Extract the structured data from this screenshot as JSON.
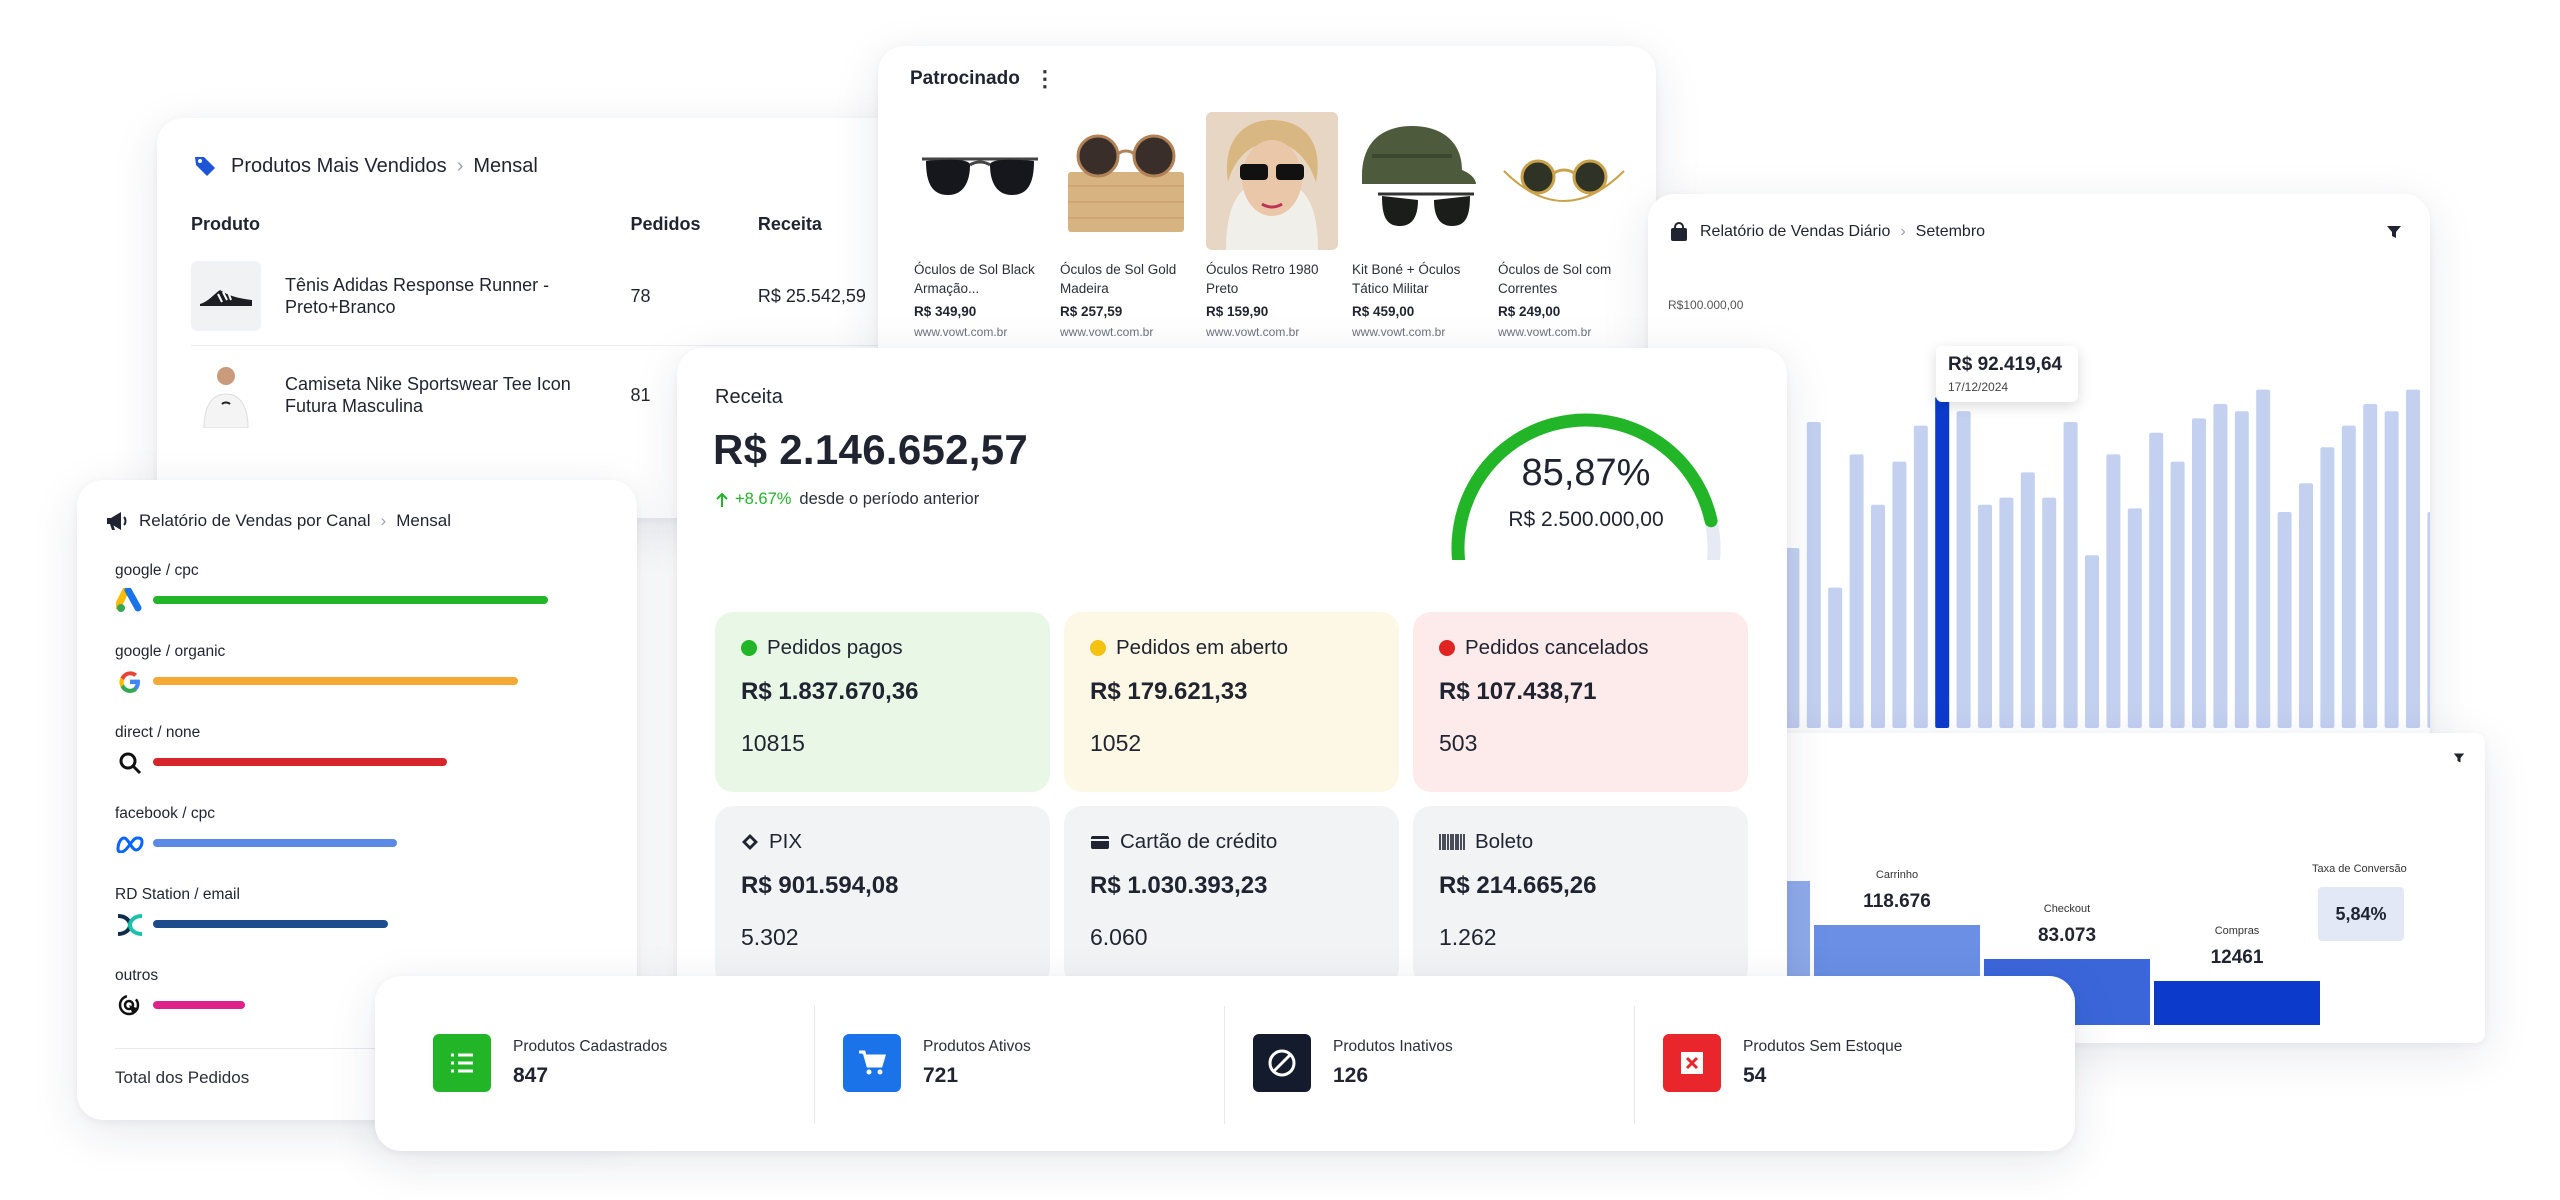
{
  "best_sellers": {
    "title": "Produtos Mais Vendidos",
    "period": "Mensal",
    "columns": [
      "Produto",
      "Pedidos",
      "Receita"
    ],
    "rows": [
      {
        "name_line1": "Tênis Adidas Response Runner -",
        "name_line2": "Preto+Branco",
        "orders": "78",
        "revenue": "R$ 25.542,59"
      },
      {
        "name_line1": "Camiseta Nike Sportswear Tee Icon",
        "name_line2": "Futura Masculina",
        "orders": "81",
        "revenue": ""
      }
    ]
  },
  "sponsored": {
    "title": "Patrocinado",
    "products": [
      {
        "name": "Óculos de Sol Black Armação...",
        "price": "R$ 349,90",
        "store": "www.vowt.com.br"
      },
      {
        "name": "Óculos de Sol Gold Madeira",
        "price": "R$ 257,59",
        "store": "www.vowt.com.br"
      },
      {
        "name": "Óculos Retro 1980 Preto",
        "price": "R$ 159,90",
        "store": "www.vowt.com.br"
      },
      {
        "name": "Kit Boné + Óculos Tático Militar",
        "price": "R$ 459,00",
        "store": "www.vowt.com.br"
      },
      {
        "name": "Óculos de Sol com Correntes",
        "price": "R$ 249,00",
        "store": "www.vowt.com.br"
      }
    ]
  },
  "daily_sales": {
    "title": "Relatório de Vendas Diário",
    "period": "Setembro",
    "y_top_label": "R$100.000,00",
    "tooltip_value": "R$ 92.419,64",
    "tooltip_date": "17/12/2024",
    "highlight_index": 8
  },
  "chart_data": {
    "type": "bar",
    "title": "Relatório de Vendas Diário",
    "series": [
      {
        "values": [
          62,
          50,
          85,
          39,
          76,
          62,
          74,
          84,
          92,
          88,
          62,
          64,
          71,
          64,
          85,
          48,
          76,
          61,
          82,
          74,
          86,
          90,
          88,
          94,
          60,
          68,
          78,
          84,
          90,
          88,
          94,
          60
        ]
      }
    ],
    "ylim": [
      0,
      100000
    ],
    "highlight": {
      "index": 8,
      "label": "R$ 92.419,64",
      "date": "17/12/2024"
    }
  },
  "funnel": {
    "stages": [
      {
        "label": "Carrinho",
        "value": "118.676",
        "level": 0.58
      },
      {
        "label": "Checkout",
        "value": "83.073",
        "level": 0.41
      },
      {
        "label": "Compras",
        "value": "12461",
        "level": 0.27
      }
    ],
    "conversion_label": "Taxa de Conversão",
    "conversion_value": "5,84%"
  },
  "channels": {
    "title": "Relatório de Vendas por Canal",
    "period": "Mensal",
    "items": [
      {
        "label": "google / cpc",
        "color": "#22b527",
        "share": 0.94
      },
      {
        "label": "google / organic",
        "color": "#f4a934",
        "share": 0.87
      },
      {
        "label": "direct / none",
        "color": "#d6262b",
        "share": 0.7
      },
      {
        "label": "facebook / cpc",
        "color": "#5b8ae6",
        "share": 0.58
      },
      {
        "label": "RD Station / email",
        "color": "#1e4b8c",
        "share": 0.56
      },
      {
        "label": "outros",
        "color": "#e0218a",
        "share": 0.22
      }
    ],
    "total_label": "Total dos Pedidos"
  },
  "revenue": {
    "label": "Receita",
    "value": "R$ 2.146.652,57",
    "change": "+8.67%",
    "change_text": "desde o período anterior",
    "gauge_percent": "85,87%",
    "gauge_fraction": 0.8587,
    "gauge_goal": "R$ 2.500.000,00",
    "tiles": [
      {
        "title": "Pedidos pagos",
        "amount": "R$ 1.837.670,36",
        "count": "10815",
        "bg": "#e9f7e6",
        "dot": "#22b527"
      },
      {
        "title": "Pedidos em aberto",
        "amount": "R$ 179.621,33",
        "count": "1052",
        "bg": "#fdf8e6",
        "dot": "#f5c211"
      },
      {
        "title": "Pedidos cancelados",
        "amount": "R$ 107.438,71",
        "count": "503",
        "bg": "#fdeaea",
        "dot": "#e02424"
      },
      {
        "title": "PIX",
        "amount": "R$ 901.594,08",
        "count": "5.302",
        "bg": "#f2f3f5"
      },
      {
        "title": "Cartão de crédito",
        "amount": "R$ 1.030.393,23",
        "count": "6.060",
        "bg": "#f2f3f5"
      },
      {
        "title": "Boleto",
        "amount": "R$ 214.665,26",
        "count": "1.262",
        "bg": "#f2f3f5"
      }
    ]
  },
  "stats": [
    {
      "label": "Produtos Cadastrados",
      "value": "847",
      "color": "#22b527",
      "icon": "list-icon"
    },
    {
      "label": "Produtos Ativos",
      "value": "721",
      "color": "#1a73e8",
      "icon": "cart-icon"
    },
    {
      "label": "Produtos Inativos",
      "value": "126",
      "color": "#141b2d",
      "icon": "block-icon"
    },
    {
      "label": "Produtos Sem Estoque",
      "value": "54",
      "color": "#e8262b",
      "icon": "close-box-icon"
    }
  ]
}
